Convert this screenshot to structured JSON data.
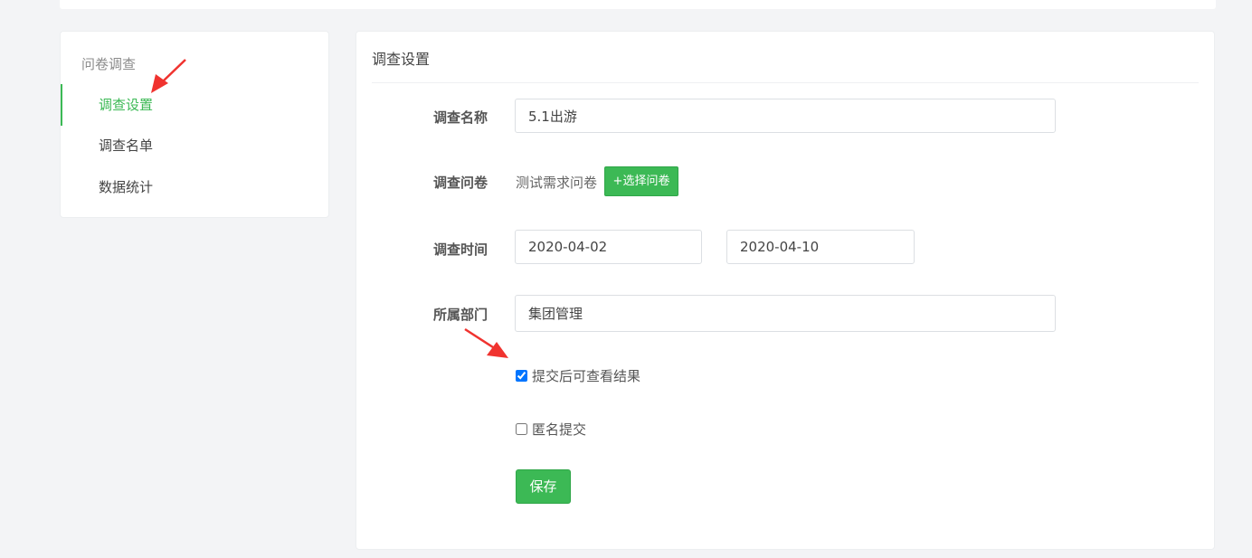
{
  "sidebar": {
    "header": "问卷调查",
    "items": [
      {
        "label": "调查设置",
        "active": true
      },
      {
        "label": "调查名单",
        "active": false
      },
      {
        "label": "数据统计",
        "active": false
      }
    ]
  },
  "main": {
    "title": "调查设置",
    "form": {
      "name_label": "调查名称",
      "name_value": "5.1出游",
      "questionnaire_label": "调查问卷",
      "questionnaire_value": "测试需求问卷",
      "select_button": "+选择问卷",
      "time_label": "调查时间",
      "start_date": "2020-04-02",
      "end_date": "2020-04-10",
      "dept_label": "所属部门",
      "dept_value": "集团管理",
      "view_result_label": "提交后可查看结果",
      "view_result_checked": true,
      "anonymous_label": "匿名提交",
      "anonymous_checked": false,
      "save_button": "保存"
    }
  },
  "colors": {
    "accent": "#3cb955",
    "annotation_arrow": "#f0332f"
  }
}
